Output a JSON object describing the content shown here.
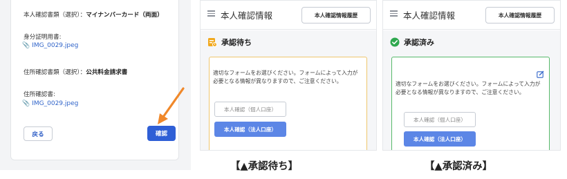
{
  "confirm_form": {
    "id_doc_type_label": "本人確認書類（選択）：",
    "id_doc_type_value": "マイナンバーカード（両面）",
    "id_doc_label": "身分証明用書:",
    "id_doc_file": "IMG_0029.jpeg",
    "addr_doc_type_label": "住所確認書類（選択）：",
    "addr_doc_type_value": "公共料金請求書",
    "addr_doc_label": "住所確認書:",
    "addr_doc_file": "IMG_0029.jpeg",
    "back_button": "戻る",
    "confirm_button": "確認",
    "arrow_color": "#f0882a"
  },
  "pending_panel": {
    "title": "本人確認情報",
    "history_button": "本人確認情報履歴",
    "status": "承認待ち",
    "status_icon": "pending-document-icon",
    "note": "適切なフォームをお選びください。フォームによって入力が必要となる情報が異なりますので、ご注意ください。",
    "individual_button": "本人確認（個人口座）",
    "corporate_button": "本人確認（法人口座）",
    "border_color": "#efc66c"
  },
  "approved_panel": {
    "title": "本人確認情報",
    "history_button": "本人確認情報履歴",
    "status": "承認済み",
    "status_icon": "check-circle-icon",
    "note": "適切なフォームをお選びください。フォームによって入力が必要となる情報が異なりますので、ご注意ください。",
    "individual_button": "本人確認（個人口座）",
    "corporate_button": "本人確認（法人口座）",
    "border_color": "#56b96a"
  },
  "captions": {
    "pending": "【▲承認待ち】",
    "approved": "【▲承認済み】"
  }
}
